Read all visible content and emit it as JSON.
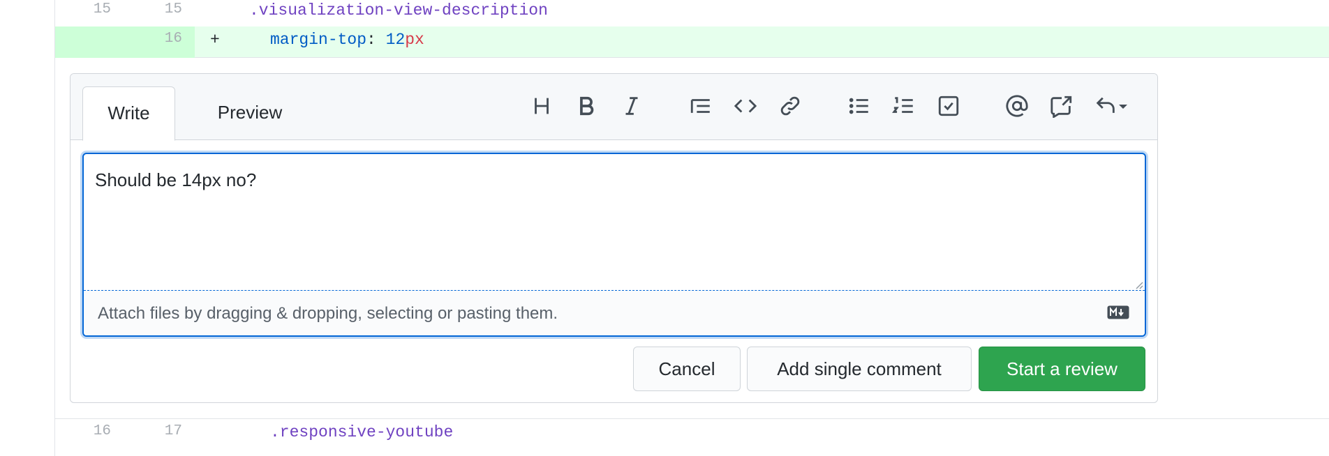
{
  "diff": {
    "rows_before": [
      {
        "old": "15",
        "new": "15",
        "marker": "",
        "code": ".visualization-view-description"
      },
      {
        "old": "",
        "new": "16",
        "marker": "+",
        "property": "margin-top",
        "separator": ": ",
        "number": "12",
        "unit": "px"
      }
    ],
    "rows_after": [
      {
        "old": "16",
        "new": "17",
        "code": ".responsive-youtube"
      }
    ]
  },
  "comment": {
    "tabs": {
      "write": "Write",
      "preview": "Preview"
    },
    "toolbar_icons": [
      "heading-icon",
      "bold-icon",
      "italic-icon",
      "quote-icon",
      "code-icon",
      "link-icon",
      "unordered-list-icon",
      "ordered-list-icon",
      "task-list-icon",
      "mention-icon",
      "cross-reference-icon",
      "saved-reply-icon"
    ],
    "textarea_value": "Should be 14px no?",
    "attach_text": "Attach files by dragging & dropping, selecting or pasting them.",
    "buttons": {
      "cancel": "Cancel",
      "single": "Add single comment",
      "review": "Start a review"
    }
  },
  "colors": {
    "accent": "#0366d6",
    "primary_button": "#2ea44f",
    "addition_bg": "#e6ffed"
  }
}
